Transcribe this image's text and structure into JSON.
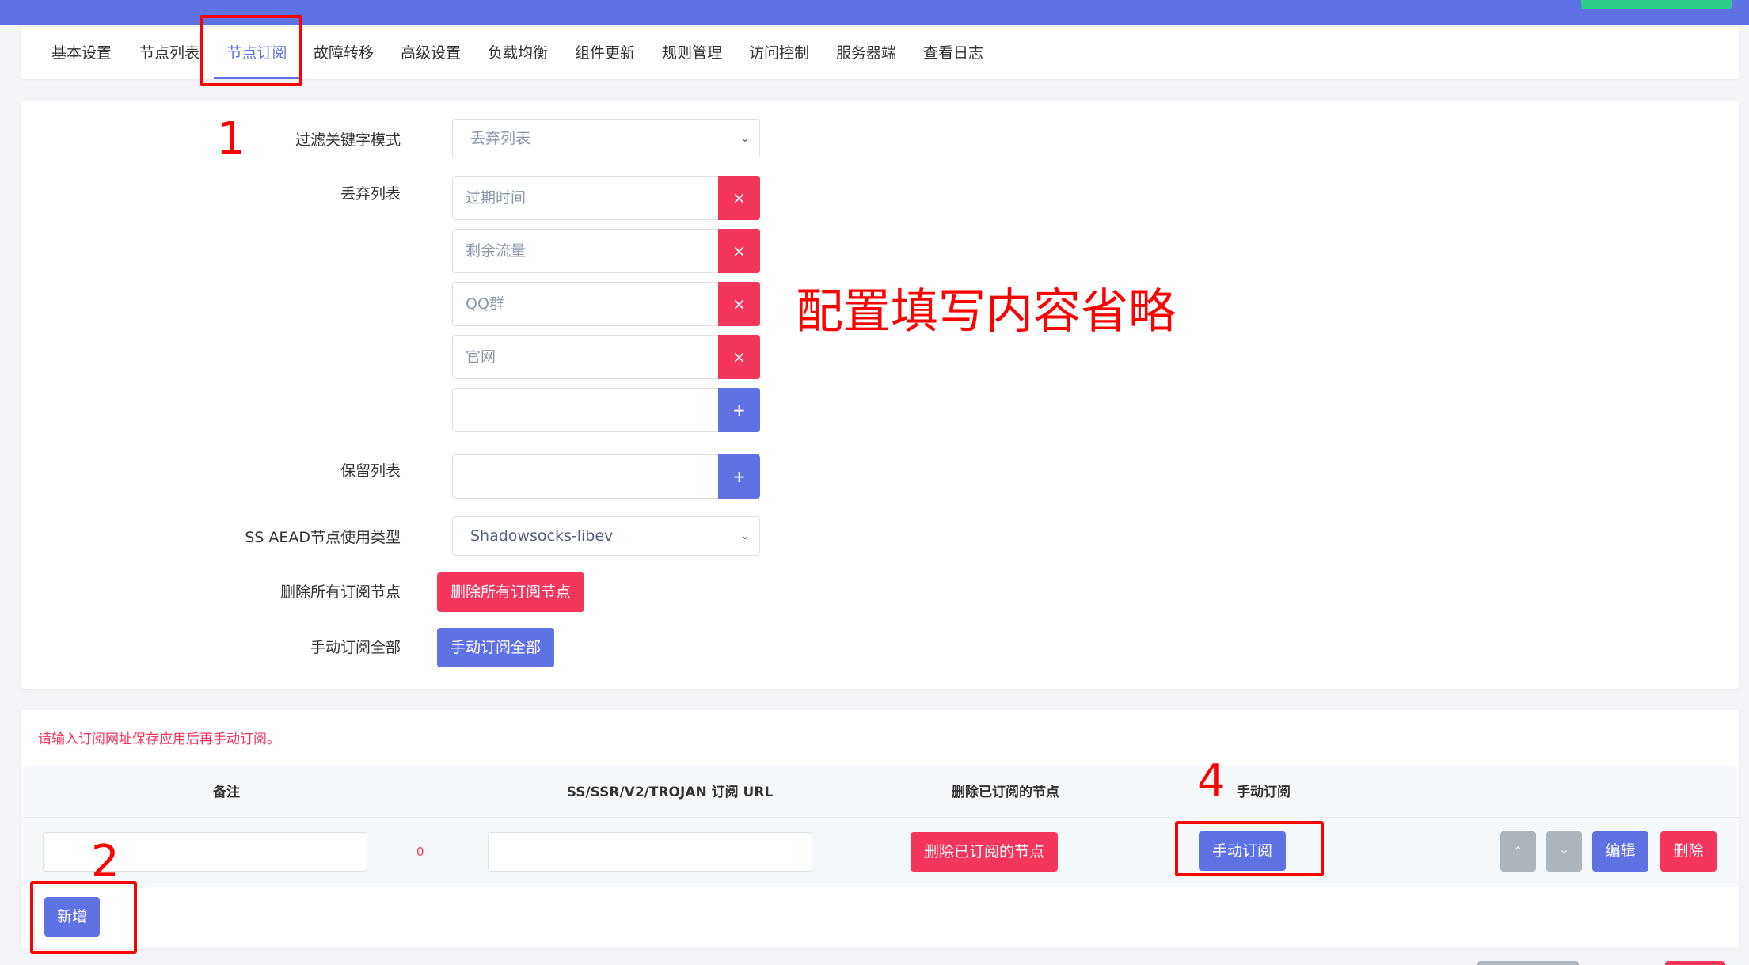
{
  "tabs": [
    {
      "label": "基本设置"
    },
    {
      "label": "节点列表"
    },
    {
      "label": "节点订阅"
    },
    {
      "label": "故障转移"
    },
    {
      "label": "高级设置"
    },
    {
      "label": "负载均衡"
    },
    {
      "label": "组件更新"
    },
    {
      "label": "规则管理"
    },
    {
      "label": "访问控制"
    },
    {
      "label": "服务器端"
    },
    {
      "label": "查看日志"
    }
  ],
  "form": {
    "filter_mode": {
      "label": "过滤关键字模式",
      "value": "丢弃列表"
    },
    "discard_list": {
      "label": "丢弃列表",
      "items": [
        {
          "value": "过期时间",
          "action": "×"
        },
        {
          "value": "剩余流量",
          "action": "×"
        },
        {
          "value": "QQ群",
          "action": "×"
        },
        {
          "value": "官网",
          "action": "×"
        }
      ],
      "new_value": "",
      "add": "+"
    },
    "keep_list": {
      "label": "保留列表",
      "value": "",
      "add": "+"
    },
    "ss_aead": {
      "label": "SS AEAD节点使用类型",
      "value": "Shadowsocks-libev"
    },
    "delete_all": {
      "label": "删除所有订阅节点",
      "button": "删除所有订阅节点"
    },
    "manual_all": {
      "label": "手动订阅全部",
      "button": "手动订阅全部"
    }
  },
  "subscriptions": {
    "notice": "请输入订阅网址保存应用后再手动订阅。",
    "headers": {
      "remark": "备注",
      "url": "SS/SSR/V2/TROJAN 订阅 URL",
      "delete_subscribed": "删除已订阅的节点",
      "manual": "手动订阅"
    },
    "row": {
      "remark": "",
      "count": "0",
      "url": "",
      "delete_button": "删除已订阅的节点",
      "manual_button": "手动订阅",
      "up": "⌃",
      "down": "⌄",
      "edit": "编辑",
      "delete": "删除"
    },
    "add_button": "新增"
  },
  "annotations": {
    "note": "配置填写内容省略",
    "n1": "1",
    "n2": "2",
    "n4": "4"
  },
  "colors": {
    "primary": "#5e72e4",
    "danger": "#f5365c",
    "success": "#2dce89",
    "annotation": "#ff0000"
  }
}
